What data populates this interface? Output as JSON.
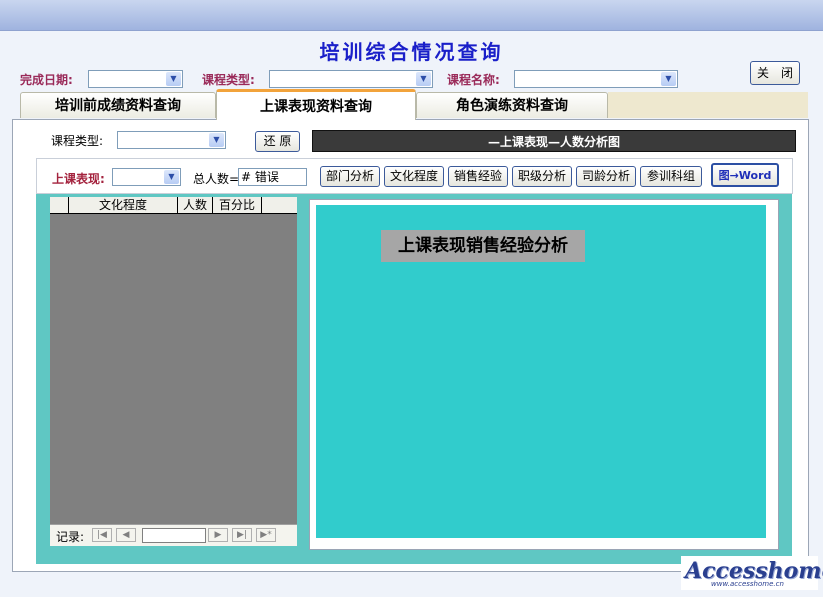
{
  "form": {
    "title": "培训综合情况查询"
  },
  "filters": {
    "date_label": "完成日期:",
    "course_type_label": "课程类型:",
    "course_name_label": "课程名称:",
    "close_label": "关　闭"
  },
  "tabs": [
    {
      "label": "培训前成绩资料查询"
    },
    {
      "label": "上课表现资料查询"
    },
    {
      "label": "角色演练资料查询"
    }
  ],
  "panel": {
    "course_type_label": "课程类型:",
    "restore_label": "还 原",
    "chart_header": "—上课表现—人数分析图",
    "performance_label": "上课表现:",
    "total_label": "总人数=",
    "total_value": "# 错误",
    "analysis_buttons": [
      "部门分析",
      "文化程度",
      "销售经验",
      "职级分析",
      "司龄分析",
      "参训科组"
    ],
    "to_word_label": "图→Word"
  },
  "grid": {
    "columns": [
      "文化程度",
      "人数",
      "百分比"
    ],
    "record_label": "记录:"
  },
  "chart": {
    "title": "上课表现销售经验分析"
  },
  "watermark": {
    "brand": "Accesshome",
    "url": "www.accesshome.cn"
  }
}
